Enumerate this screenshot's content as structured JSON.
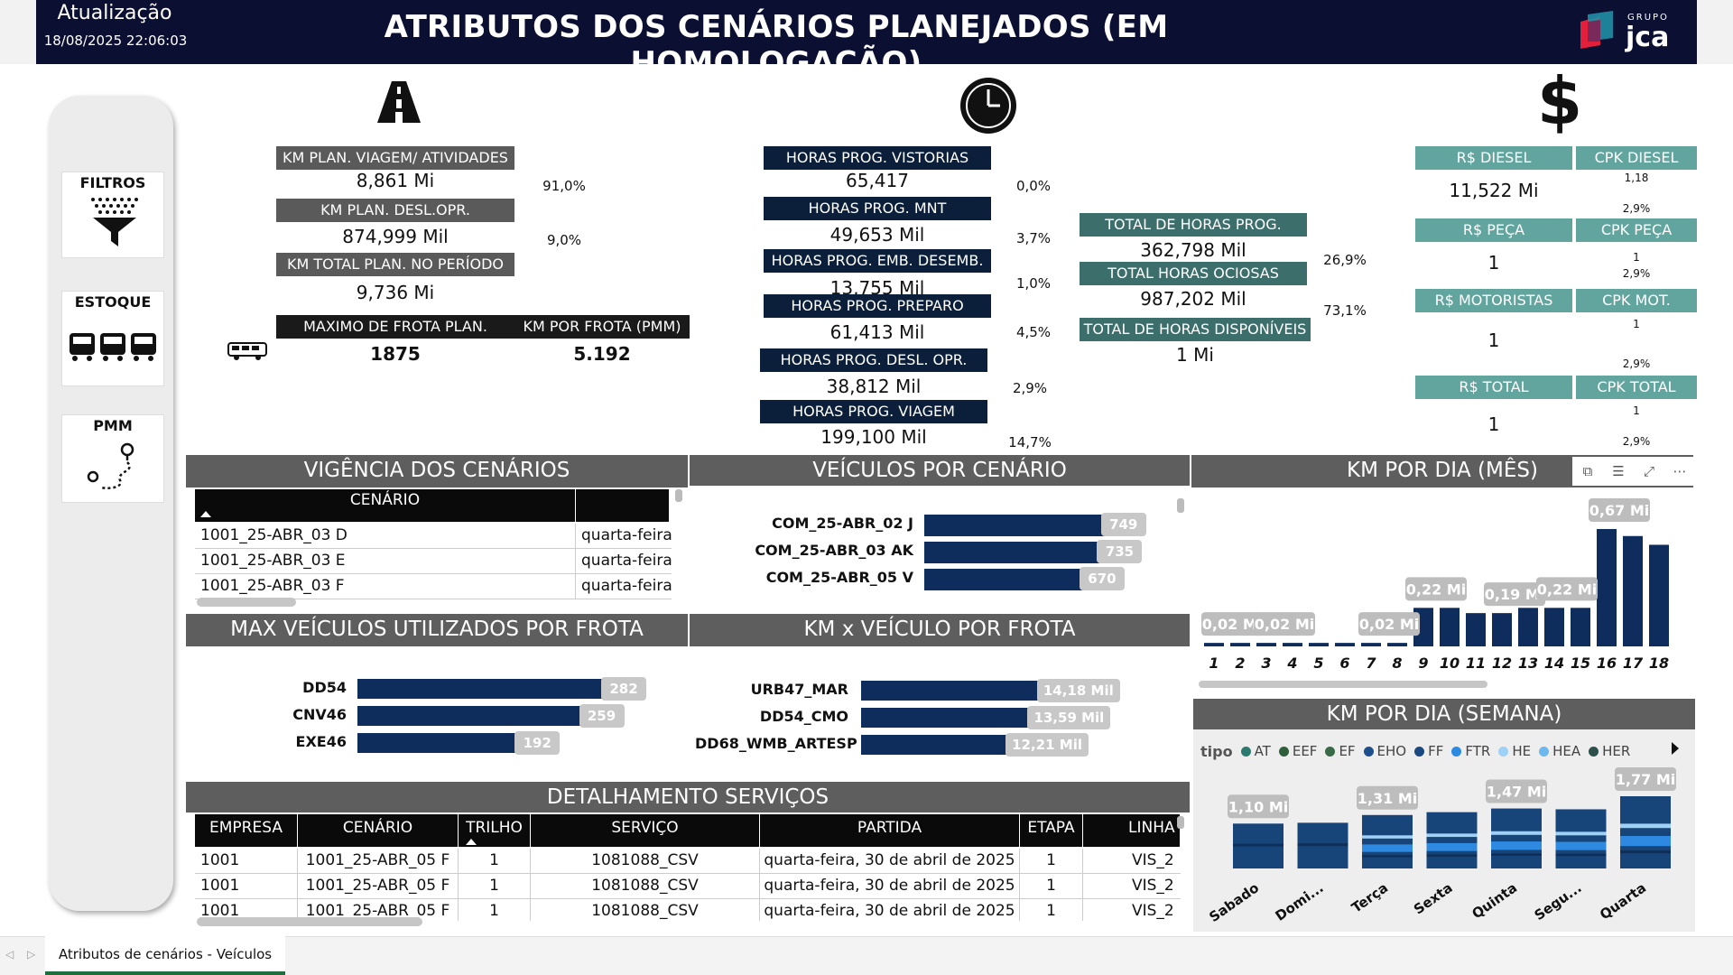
{
  "header": {
    "update_label": "Atualização",
    "update_date": "18/08/2025 22:06:03",
    "title": "ATRIBUTOS DOS CENÁRIOS PLANEJADOS (EM HOMOLOGAÇÃO)",
    "logo_small": "GRUPO",
    "logo_big": "jca"
  },
  "sidebar": {
    "filtros": "FILTROS",
    "estoque": "ESTOQUE",
    "pmm": "PMM"
  },
  "km": {
    "viagem_label": "KM PLAN. VIAGEM/ ATIVIDADES",
    "viagem_value": "8,861 Mi",
    "viagem_pct": "91,0%",
    "desl_label": "KM PLAN. DESL.OPR.",
    "desl_value": "874,999 Mil",
    "desl_pct": "9,0%",
    "total_label": "KM TOTAL PLAN. NO PERÍODO",
    "total_value": "9,736 Mi",
    "frota_label": "MAXIMO DE FROTA PLAN.",
    "frota_value": "1875",
    "pmm_label": "KM POR FROTA (PMM)",
    "pmm_value": "5.192"
  },
  "horas": {
    "vistorias_label": "HORAS PROG. VISTORIAS",
    "vistorias_value": "65,417",
    "vistorias_pct": "0,0%",
    "mnt_label": "HORAS PROG. MNT",
    "mnt_value": "49,653 Mil",
    "mnt_pct": "3,7%",
    "emb_label": "HORAS PROG. EMB. DESEMB.",
    "emb_value": "13,755 Mil",
    "emb_pct": "1,0%",
    "preparo_label": "HORAS PROG. PREPARO",
    "preparo_value": "61,413 Mil",
    "preparo_pct": "4,5%",
    "desl_label": "HORAS PROG. DESL. OPR.",
    "desl_value": "38,812 Mil",
    "desl_pct": "2,9%",
    "viagem_label": "HORAS PROG. VIAGEM",
    "viagem_value": "199,100 Mil",
    "viagem_pct": "14,7%"
  },
  "totais": {
    "prog_label": "TOTAL DE HORAS PROG.",
    "prog_value": "362,798 Mil",
    "prog_pct": "26,9%",
    "ociosas_label": "TOTAL HORAS OCIOSAS",
    "ociosas_value": "987,202 Mil",
    "ociosas_pct": "73,1%",
    "disp_label": "TOTAL DE HORAS DISPONÍVEIS",
    "disp_value": "1 Mi"
  },
  "custos": {
    "diesel_label": "R$ DIESEL",
    "diesel_value": "11,522 Mi",
    "cpk_diesel_label": "CPK DIESEL",
    "cpk_diesel_value": "1,18",
    "cpk_diesel_pct": "2,9%",
    "peca_label": "R$ PEÇA",
    "peca_value": "1",
    "cpk_peca_label": "CPK PEÇA",
    "cpk_peca_value": "1",
    "cpk_peca_pct": "2,9%",
    "mot_label": "R$ MOTORISTAS",
    "mot_value": "1",
    "cpk_mot_label": "CPK MOT.",
    "cpk_mot_value": "1",
    "cpk_mot_pct": "2,9%",
    "total_label": "R$ TOTAL",
    "total_value": "1",
    "cpk_total_label": "CPK TOTAL",
    "cpk_total_value": "1",
    "cpk_total_pct": "2,9%"
  },
  "vigencia": {
    "title": "VIGÊNCIA DOS CENÁRIOS",
    "col_cenario": "CENÁRIO",
    "rows": [
      {
        "cenario": "1001_25-ABR_03 D",
        "dia": "quarta-feira"
      },
      {
        "cenario": "1001_25-ABR_03 E",
        "dia": "quarta-feira"
      },
      {
        "cenario": "1001_25-ABR_03 F",
        "dia": "quarta-feira"
      }
    ]
  },
  "veiculos_cenario": {
    "title": "VEÍCULOS POR CENÁRIO",
    "items": [
      {
        "label": "COM_25-ABR_02 J",
        "value": 749,
        "text": "749"
      },
      {
        "label": "COM_25-ABR_03 AK",
        "value": 735,
        "text": "735"
      },
      {
        "label": "COM_25-ABR_05 V",
        "value": 670,
        "text": "670"
      }
    ]
  },
  "max_veiculos": {
    "title": "MAX VEÍCULOS UTILIZADOS POR FROTA",
    "items": [
      {
        "label": "DD54",
        "value": 282,
        "text": "282"
      },
      {
        "label": "CNV46",
        "value": 259,
        "text": "259"
      },
      {
        "label": "EXE46",
        "value": 192,
        "text": "192"
      }
    ]
  },
  "km_veiculo": {
    "title": "KM x VEÍCULO POR FROTA",
    "items": [
      {
        "label": "URB47_MAR",
        "value": 14.18,
        "text": "14,18 Mil"
      },
      {
        "label": "DD54_CMO",
        "value": 13.59,
        "text": "13,59 Mil"
      },
      {
        "label": "DD68_WMB_ARTESP",
        "value": 12.21,
        "text": "12,21 Mil"
      }
    ]
  },
  "detalhamento": {
    "title": "DETALHAMENTO SERVIÇOS",
    "columns": [
      "EMPRESA",
      "CENÁRIO",
      "TRILHO",
      "SERVIÇO",
      "PARTIDA",
      "ETAPA",
      "LINHA"
    ],
    "rows": [
      [
        "1001",
        "1001_25-ABR_05 F",
        "1",
        "1081088_CSV",
        "quarta-feira, 30 de abril de 2025",
        "1",
        "VIS_2"
      ],
      [
        "1001",
        "1001_25-ABR_05 F",
        "1",
        "1081088_CSV",
        "quarta-feira, 30 de abril de 2025",
        "1",
        "VIS_2"
      ],
      [
        "1001",
        "1001_25-ABR_05 F",
        "1",
        "1081088_CSV",
        "quarta-feira, 30 de abril de 2025",
        "1",
        "VIS_2"
      ]
    ]
  },
  "chart_data": [
    {
      "type": "bar",
      "title": "KM POR DIA (MÊS)",
      "categories": [
        "1",
        "2",
        "3",
        "4",
        "5",
        "6",
        "7",
        "8",
        "9",
        "10",
        "11",
        "12",
        "13",
        "14",
        "15",
        "16",
        "17",
        "18"
      ],
      "values": [
        0.02,
        0.02,
        0.02,
        0.02,
        0.02,
        0.02,
        0.02,
        0.02,
        0.22,
        0.22,
        0.19,
        0.19,
        0.22,
        0.22,
        0.22,
        0.67,
        0.63,
        0.58
      ],
      "data_labels": [
        {
          "index": 0,
          "text": "0,02 Mi"
        },
        {
          "index": 2,
          "text": "0,02 Mi"
        },
        {
          "index": 6,
          "text": "0,02 Mi"
        },
        {
          "index": 8,
          "text": "0,22 Mi"
        },
        {
          "index": 11,
          "text": "0,19 Mi"
        },
        {
          "index": 13,
          "text": "0,22 Mi"
        },
        {
          "index": 15,
          "text": "0,67 Mi"
        }
      ],
      "color": "#0f2d5c"
    },
    {
      "type": "bar",
      "title": "KM POR DIA (SEMANA)",
      "legend_title": "tipo",
      "legend": [
        {
          "name": "AT",
          "color": "#2a7a6f"
        },
        {
          "name": "EEF",
          "color": "#2f5f3a"
        },
        {
          "name": "EF",
          "color": "#3a6b48"
        },
        {
          "name": "EHO",
          "color": "#1d4f8c"
        },
        {
          "name": "FF",
          "color": "#1b4a82"
        },
        {
          "name": "FTR",
          "color": "#2d8ae0"
        },
        {
          "name": "HE",
          "color": "#9fd0f5"
        },
        {
          "name": "HEA",
          "color": "#6db7ef"
        },
        {
          "name": "HER",
          "color": "#2d4f4b"
        }
      ],
      "categories": [
        "Sabado",
        "Domi...",
        "Terça",
        "Sexta",
        "Quinta",
        "Segu...",
        "Quarta"
      ],
      "values": [
        1.1,
        1.12,
        1.31,
        1.38,
        1.47,
        1.45,
        1.77
      ],
      "data_labels": [
        {
          "index": 0,
          "text": "1,10 Mi"
        },
        {
          "index": 2,
          "text": "1,31 Mi"
        },
        {
          "index": 4,
          "text": "1,47 Mi"
        },
        {
          "index": 6,
          "text": "1,77 Mi"
        }
      ]
    }
  ],
  "footer": {
    "tab_label": "Atributos de cenários - Veículos"
  }
}
